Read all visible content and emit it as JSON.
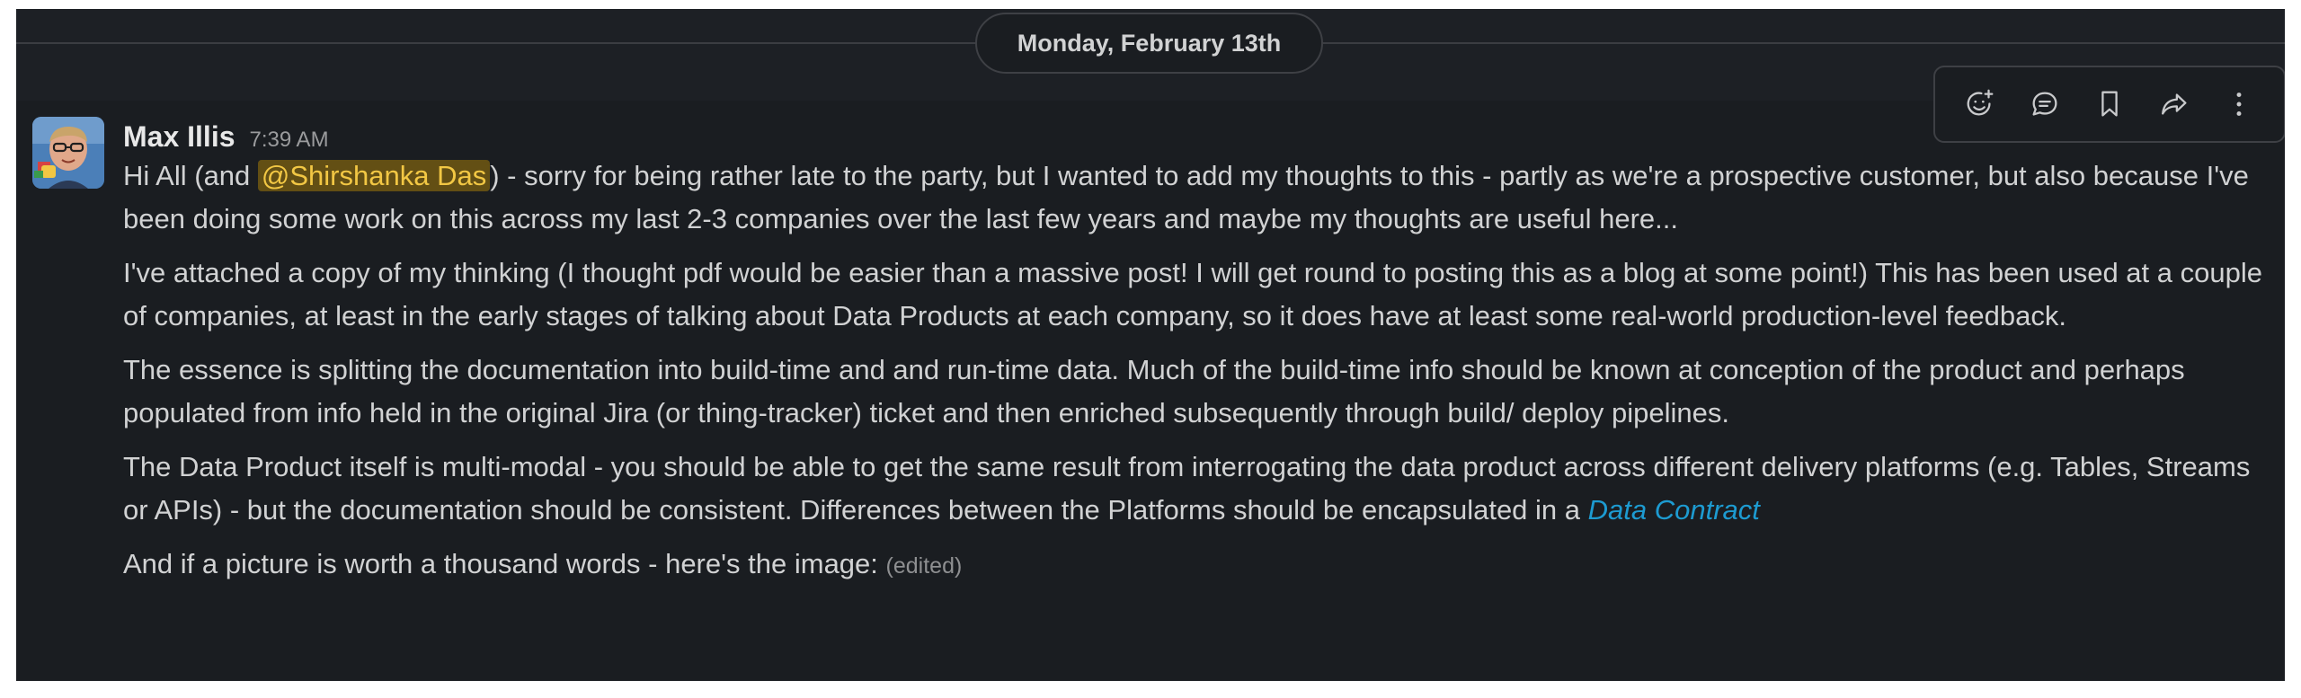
{
  "date_divider": {
    "label": "Monday, February 13th"
  },
  "toolbar": {
    "buttons": [
      {
        "name": "add-reaction",
        "icon": "emoji-add-icon"
      },
      {
        "name": "reply-in-thread",
        "icon": "speech-bubble-icon"
      },
      {
        "name": "save-for-later",
        "icon": "bookmark-icon"
      },
      {
        "name": "share-message",
        "icon": "forward-arrow-icon"
      },
      {
        "name": "more-actions",
        "icon": "vertical-dots-icon"
      }
    ]
  },
  "message": {
    "author": "Max Illis",
    "time": "7:39 AM",
    "p1": {
      "before": "Hi All (and ",
      "mention": "@Shirshanka Das",
      "after": ") - sorry for being rather late to the party, but I wanted to add my thoughts to this - partly as we're a prospective customer, but also because I've been doing some work on this across my last 2-3 companies over the last few years and maybe my thoughts are useful here..."
    },
    "p2": "I've attached a copy of my thinking (I thought pdf would be easier than a massive post! I will get round to posting this as a blog at some point!) This has been used at a couple of companies, at least in the early stages of talking about Data Products at each company, so it does have at least some real-world production-level feedback.",
    "p3": "The essence is splitting the documentation into build-time and and run-time data. Much of the build-time info should be known at conception of the product and perhaps populated from info held in the original Jira (or thing-tracker) ticket and then enriched subsequently through build/ deploy pipelines.",
    "p4": {
      "text": "The Data Product itself is multi-modal - you should be able to get the same result from interrogating the data product across different delivery platforms (e.g. Tables, Streams or APIs) - but the documentation should be consistent. Differences between the Platforms should be encapsulated in a ",
      "link": "Data Contract"
    },
    "p5": {
      "text": "And if a picture is worth a thousand words - here's the image: ",
      "edited": "(edited)"
    }
  },
  "colors": {
    "background": "#1a1d21",
    "text": "#d1d2d3",
    "mention_bg": "#634f14",
    "mention_text": "#f2c744",
    "link": "#1d9bd1"
  }
}
